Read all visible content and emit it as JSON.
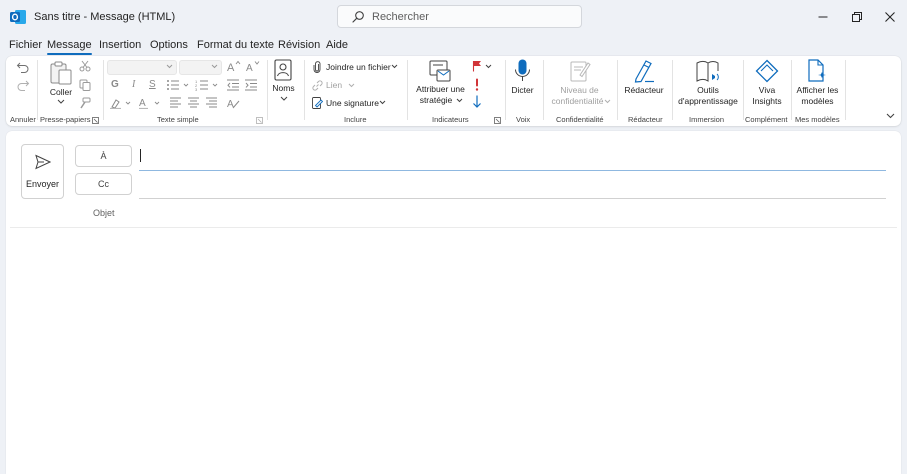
{
  "window": {
    "title": "Sans titre  -  Message (HTML)",
    "search_placeholder": "Rechercher"
  },
  "menu": {
    "tabs": [
      {
        "label": "Fichier"
      },
      {
        "label": "Message"
      },
      {
        "label": "Insertion"
      },
      {
        "label": "Options"
      },
      {
        "label": "Format du texte"
      },
      {
        "label": "Révision"
      },
      {
        "label": "Aide"
      }
    ],
    "active_index": 1
  },
  "ribbon": {
    "groups": {
      "annuler": "Annuler",
      "presse_papiers": "Presse-papiers",
      "texte_simple": "Texte simple",
      "inclure": "Inclure",
      "indicateurs": "Indicateurs",
      "voix": "Voix",
      "confidentialite": "Confidentialité",
      "redacteur": "Rédacteur",
      "immersion": "Immersion",
      "complement": "Complément",
      "mes_modeles": "Mes modèles"
    },
    "buttons": {
      "coller": "Coller",
      "noms": "Noms",
      "joindre_fichier": "Joindre un fichier",
      "lien": "Lien",
      "signature": "Une signature",
      "attribuer_1": "Attribuer une",
      "attribuer_2": "stratégie",
      "dicter": "Dicter",
      "niveau_1": "Niveau de",
      "niveau_2": "confidentialité",
      "redacteur": "Rédacteur",
      "outils_1": "Outils",
      "outils_2": "d'apprentissage",
      "viva_1": "Viva",
      "viva_2": "Insights",
      "afficher_1": "Afficher les",
      "afficher_2": "modèles"
    },
    "format_letters": {
      "bold": "G",
      "italic": "I",
      "underline": "S"
    }
  },
  "compose": {
    "send_label": "Envoyer",
    "to_label": "À",
    "cc_label": "Cc",
    "subject_label": "Objet"
  },
  "colors": {
    "accent": "#0f6cbd",
    "flag": "#d13438",
    "outlook_blue": "#0f6cbd"
  }
}
